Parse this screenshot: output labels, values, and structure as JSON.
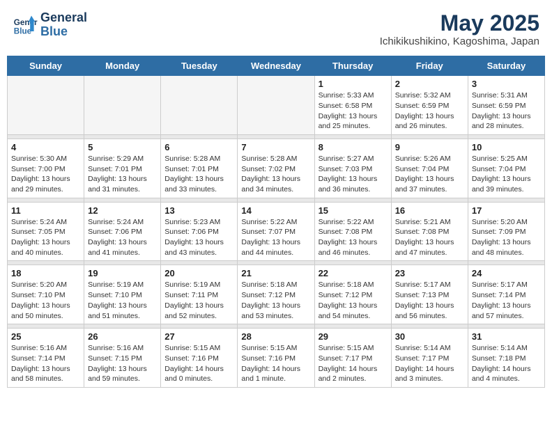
{
  "header": {
    "logo_line1": "General",
    "logo_line2": "Blue",
    "month": "May 2025",
    "location": "Ichikikushikino, Kagoshima, Japan"
  },
  "weekdays": [
    "Sunday",
    "Monday",
    "Tuesday",
    "Wednesday",
    "Thursday",
    "Friday",
    "Saturday"
  ],
  "weeks": [
    [
      {
        "day": "",
        "empty": true
      },
      {
        "day": "",
        "empty": true
      },
      {
        "day": "",
        "empty": true
      },
      {
        "day": "",
        "empty": true
      },
      {
        "day": "1",
        "sunrise": "5:33 AM",
        "sunset": "6:58 PM",
        "daylight": "13 hours and 25 minutes."
      },
      {
        "day": "2",
        "sunrise": "5:32 AM",
        "sunset": "6:59 PM",
        "daylight": "13 hours and 26 minutes."
      },
      {
        "day": "3",
        "sunrise": "5:31 AM",
        "sunset": "6:59 PM",
        "daylight": "13 hours and 28 minutes."
      }
    ],
    [
      {
        "day": "4",
        "sunrise": "5:30 AM",
        "sunset": "7:00 PM",
        "daylight": "13 hours and 29 minutes."
      },
      {
        "day": "5",
        "sunrise": "5:29 AM",
        "sunset": "7:01 PM",
        "daylight": "13 hours and 31 minutes."
      },
      {
        "day": "6",
        "sunrise": "5:28 AM",
        "sunset": "7:01 PM",
        "daylight": "13 hours and 33 minutes."
      },
      {
        "day": "7",
        "sunrise": "5:28 AM",
        "sunset": "7:02 PM",
        "daylight": "13 hours and 34 minutes."
      },
      {
        "day": "8",
        "sunrise": "5:27 AM",
        "sunset": "7:03 PM",
        "daylight": "13 hours and 36 minutes."
      },
      {
        "day": "9",
        "sunrise": "5:26 AM",
        "sunset": "7:04 PM",
        "daylight": "13 hours and 37 minutes."
      },
      {
        "day": "10",
        "sunrise": "5:25 AM",
        "sunset": "7:04 PM",
        "daylight": "13 hours and 39 minutes."
      }
    ],
    [
      {
        "day": "11",
        "sunrise": "5:24 AM",
        "sunset": "7:05 PM",
        "daylight": "13 hours and 40 minutes."
      },
      {
        "day": "12",
        "sunrise": "5:24 AM",
        "sunset": "7:06 PM",
        "daylight": "13 hours and 41 minutes."
      },
      {
        "day": "13",
        "sunrise": "5:23 AM",
        "sunset": "7:06 PM",
        "daylight": "13 hours and 43 minutes."
      },
      {
        "day": "14",
        "sunrise": "5:22 AM",
        "sunset": "7:07 PM",
        "daylight": "13 hours and 44 minutes."
      },
      {
        "day": "15",
        "sunrise": "5:22 AM",
        "sunset": "7:08 PM",
        "daylight": "13 hours and 46 minutes."
      },
      {
        "day": "16",
        "sunrise": "5:21 AM",
        "sunset": "7:08 PM",
        "daylight": "13 hours and 47 minutes."
      },
      {
        "day": "17",
        "sunrise": "5:20 AM",
        "sunset": "7:09 PM",
        "daylight": "13 hours and 48 minutes."
      }
    ],
    [
      {
        "day": "18",
        "sunrise": "5:20 AM",
        "sunset": "7:10 PM",
        "daylight": "13 hours and 50 minutes."
      },
      {
        "day": "19",
        "sunrise": "5:19 AM",
        "sunset": "7:10 PM",
        "daylight": "13 hours and 51 minutes."
      },
      {
        "day": "20",
        "sunrise": "5:19 AM",
        "sunset": "7:11 PM",
        "daylight": "13 hours and 52 minutes."
      },
      {
        "day": "21",
        "sunrise": "5:18 AM",
        "sunset": "7:12 PM",
        "daylight": "13 hours and 53 minutes."
      },
      {
        "day": "22",
        "sunrise": "5:18 AM",
        "sunset": "7:12 PM",
        "daylight": "13 hours and 54 minutes."
      },
      {
        "day": "23",
        "sunrise": "5:17 AM",
        "sunset": "7:13 PM",
        "daylight": "13 hours and 56 minutes."
      },
      {
        "day": "24",
        "sunrise": "5:17 AM",
        "sunset": "7:14 PM",
        "daylight": "13 hours and 57 minutes."
      }
    ],
    [
      {
        "day": "25",
        "sunrise": "5:16 AM",
        "sunset": "7:14 PM",
        "daylight": "13 hours and 58 minutes."
      },
      {
        "day": "26",
        "sunrise": "5:16 AM",
        "sunset": "7:15 PM",
        "daylight": "13 hours and 59 minutes."
      },
      {
        "day": "27",
        "sunrise": "5:15 AM",
        "sunset": "7:16 PM",
        "daylight": "14 hours and 0 minutes."
      },
      {
        "day": "28",
        "sunrise": "5:15 AM",
        "sunset": "7:16 PM",
        "daylight": "14 hours and 1 minute."
      },
      {
        "day": "29",
        "sunrise": "5:15 AM",
        "sunset": "7:17 PM",
        "daylight": "14 hours and 2 minutes."
      },
      {
        "day": "30",
        "sunrise": "5:14 AM",
        "sunset": "7:17 PM",
        "daylight": "14 hours and 3 minutes."
      },
      {
        "day": "31",
        "sunrise": "5:14 AM",
        "sunset": "7:18 PM",
        "daylight": "14 hours and 4 minutes."
      }
    ]
  ]
}
